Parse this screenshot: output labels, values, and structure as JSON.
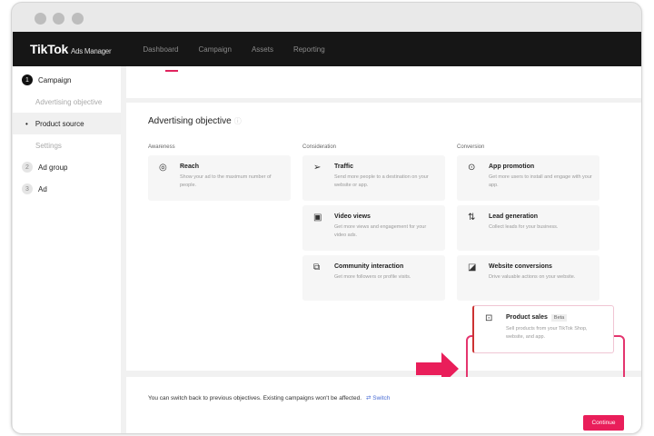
{
  "nav": {
    "logo": "TikTok",
    "logo_sub": "Ads Manager",
    "links": [
      "Dashboard",
      "Campaign",
      "Assets",
      "Reporting"
    ]
  },
  "sidebar": {
    "items": [
      {
        "num": "1",
        "label": "Campaign"
      },
      {
        "label": "Advertising objective"
      },
      {
        "label": "Product source",
        "bullet": "•"
      },
      {
        "label": "Settings"
      },
      {
        "num": "2",
        "label": "Ad group"
      },
      {
        "num": "3",
        "label": "Ad"
      }
    ]
  },
  "main": {
    "title": "Advertising objective",
    "info_icon": "ⓘ",
    "columns": [
      "Awareness",
      "Consideration",
      "Conversion"
    ],
    "objectives": [
      {
        "name": "Reach",
        "desc": "Show your ad to the maximum number of people."
      },
      {
        "name": "Traffic",
        "desc": "Send more people to a destination on your website or app."
      },
      {
        "name": "Video views",
        "desc": "Get more views and engagement for your video ads."
      },
      {
        "name": "Community interaction",
        "desc": "Get more followers or profile visits."
      },
      {
        "name": "App promotion",
        "desc": "Get more users to install and engage with your app."
      },
      {
        "name": "Lead generation",
        "desc": "Collect leads for your business."
      },
      {
        "name": "Website conversions",
        "desc": "Drive valuable actions on your website."
      },
      {
        "name": "Product sales",
        "badge": "Beta",
        "desc": "Sell products from your TikTok Shop, website, and app."
      }
    ]
  },
  "footer": {
    "note": "You can switch back to previous objectives. Existing campaigns won't be affected.",
    "switch": "⇄ Switch",
    "continue": "Continue"
  },
  "colors": {
    "accent": "#e91e5a"
  }
}
